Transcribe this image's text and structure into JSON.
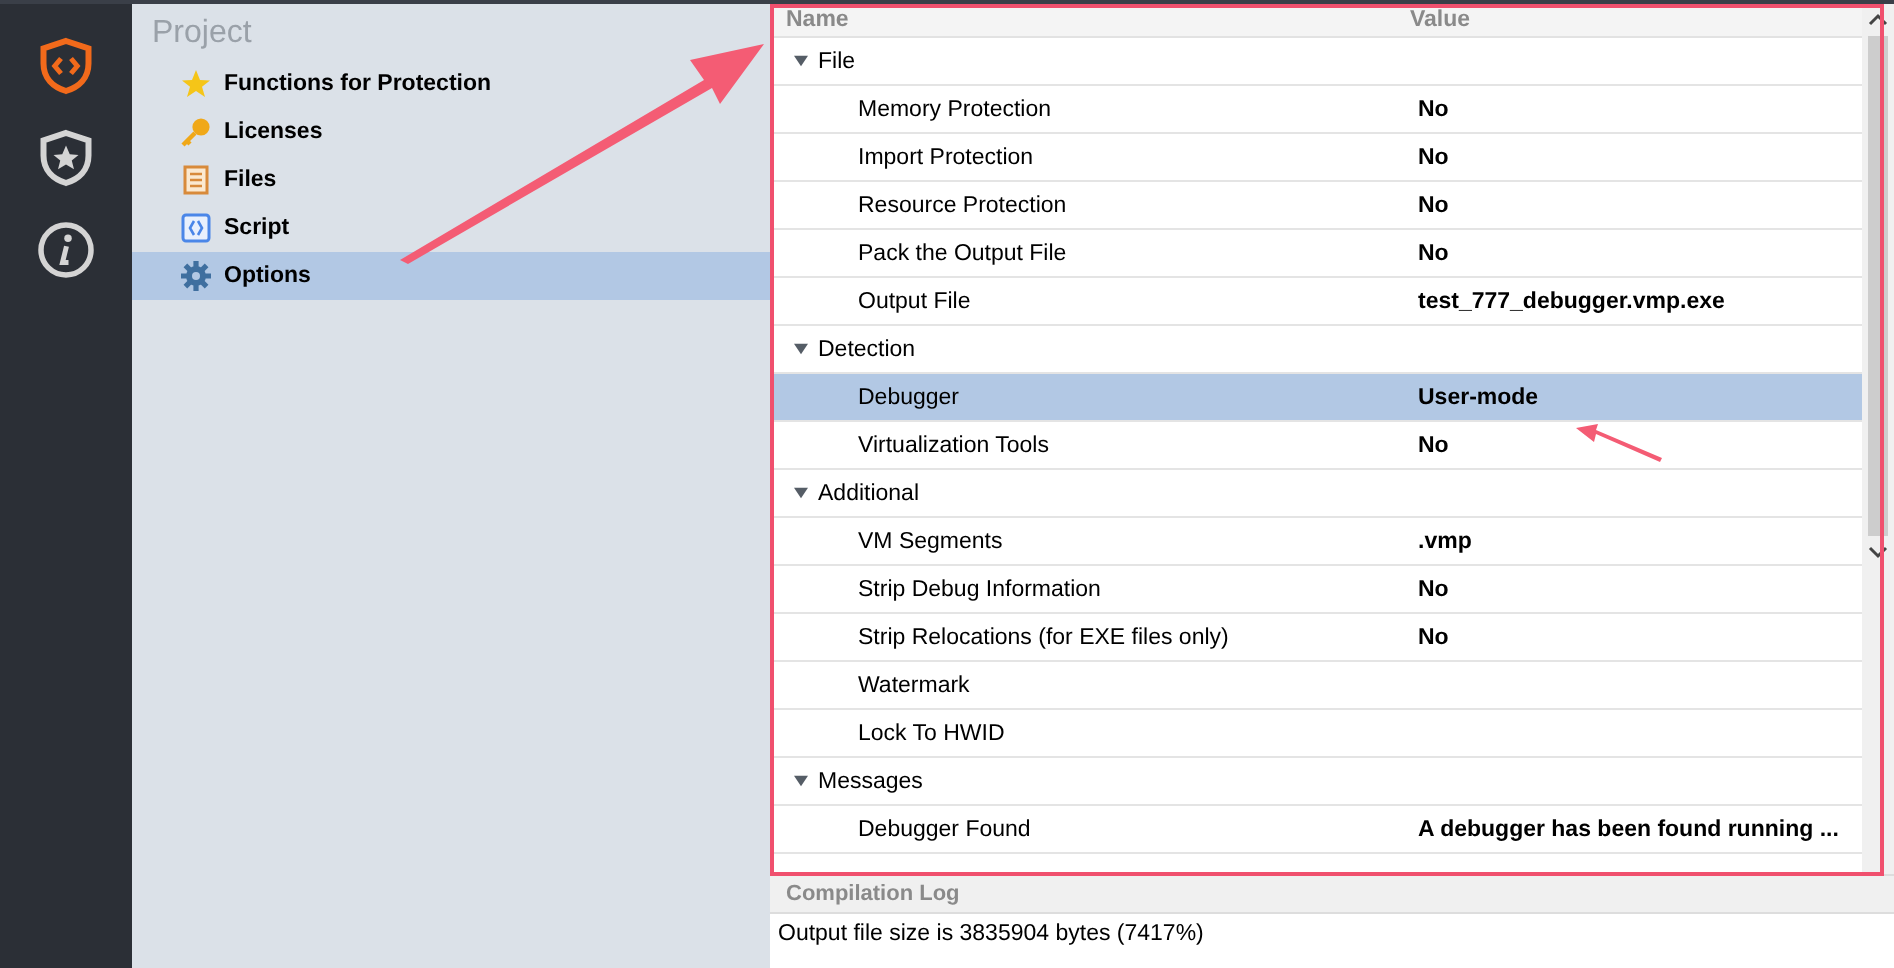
{
  "nav_rail": [
    {
      "selected": true
    },
    {
      "selected": false
    },
    {
      "selected": false
    }
  ],
  "project": {
    "title": "Project",
    "items": [
      {
        "label": "Functions for Protection",
        "selected": false
      },
      {
        "label": "Licenses",
        "selected": false
      },
      {
        "label": "Files",
        "selected": false
      },
      {
        "label": "Script",
        "selected": false
      },
      {
        "label": "Options",
        "selected": true
      }
    ]
  },
  "properties": {
    "columns": [
      "Name",
      "Value"
    ],
    "groups": [
      {
        "name": "File",
        "expanded": true,
        "children": [
          {
            "name": "Memory Protection",
            "value": "No",
            "selected": false
          },
          {
            "name": "Import Protection",
            "value": "No",
            "selected": false
          },
          {
            "name": "Resource Protection",
            "value": "No",
            "selected": false
          },
          {
            "name": "Pack the Output File",
            "value": "No",
            "selected": false
          },
          {
            "name": "Output File",
            "value": "test_777_debugger.vmp.exe",
            "selected": false
          }
        ]
      },
      {
        "name": "Detection",
        "expanded": true,
        "children": [
          {
            "name": "Debugger",
            "value": "User-mode",
            "selected": true
          },
          {
            "name": "Virtualization Tools",
            "value": "No",
            "selected": false
          }
        ]
      },
      {
        "name": "Additional",
        "expanded": true,
        "children": [
          {
            "name": "VM Segments",
            "value": ".vmp",
            "selected": false
          },
          {
            "name": "Strip Debug Information",
            "value": "No",
            "selected": false
          },
          {
            "name": "Strip Relocations (for EXE files only)",
            "value": "No",
            "selected": false
          },
          {
            "name": "Watermark",
            "selected": false
          },
          {
            "name": "Lock To HWID",
            "selected": false
          }
        ]
      },
      {
        "name": "Messages",
        "expanded": true,
        "children": [
          {
            "name": "Debugger Found",
            "value": "A debugger has been found running ...",
            "selected": false
          }
        ]
      }
    ]
  },
  "compilation_log": {
    "title": "Compilation Log",
    "lines": [
      "Output file size is 3835904 bytes (7417%)"
    ]
  }
}
